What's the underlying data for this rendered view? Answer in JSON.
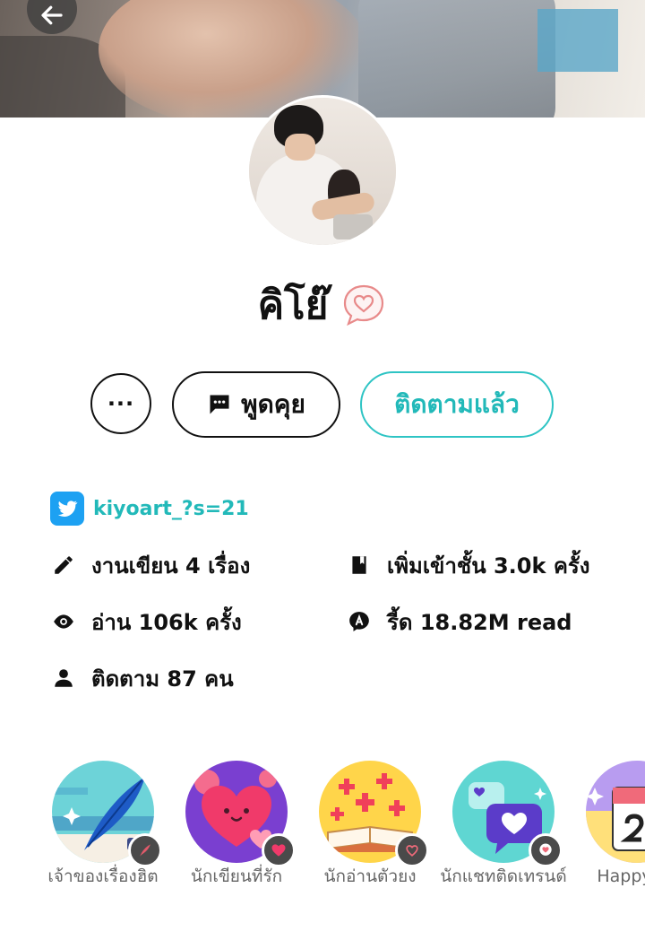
{
  "profile": {
    "name": "คิโย๊",
    "twitter_handle": "kiyoart_?s=21"
  },
  "actions": {
    "more_label": "···",
    "chat_label": "พูดคุย",
    "follow_label": "ติดตามแล้ว"
  },
  "stats": {
    "works": "งานเขียน 4 เรื่อง",
    "library_adds": "เพิ่มเข้าชั้น 3.0k ครั้ง",
    "reads": "อ่าน 106k ครั้ง",
    "reed": "รี้ด 18.82M read",
    "following": "ติดตาม 87 คน"
  },
  "badges": [
    {
      "label": "เจ้าของเรื่องฮิต",
      "icon": "feather-quill-icon"
    },
    {
      "label": "นักเขียนที่รัก",
      "icon": "heart-icon"
    },
    {
      "label": "นักอ่านตัวยง",
      "icon": "open-book-icon"
    },
    {
      "label": "นักแชทติดเทรนด์",
      "icon": "chat-bubble-heart-icon"
    },
    {
      "label": "Happy Le",
      "icon": "calendar-icon"
    }
  ],
  "colors": {
    "accent": "#22b9b9",
    "twitter": "#1da1f2",
    "heart": "#e88a8a"
  }
}
